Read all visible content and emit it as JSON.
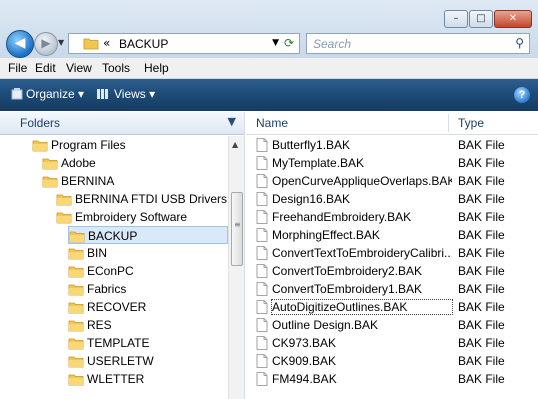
{
  "window": {
    "controls": {
      "minimize": "–",
      "maximize": "□",
      "close": "✕"
    }
  },
  "nav": {
    "back_glyph": "◀",
    "forward_glyph": "▶",
    "address_chevron": "«",
    "address_path": "BACKUP",
    "refresh_glyph": "⟳",
    "search_placeholder": "Search",
    "search_glyph": "⚲"
  },
  "menubar": {
    "items": [
      "File",
      "Edit",
      "View",
      "Tools",
      "Help"
    ]
  },
  "toolbar": {
    "organize": "Organize",
    "views": "Views",
    "help_glyph": "?"
  },
  "folders_pane": {
    "header": "Folders",
    "items": [
      {
        "label": "Program Files",
        "level": 0,
        "selected": false
      },
      {
        "label": "Adobe",
        "level": 1,
        "selected": false
      },
      {
        "label": "BERNINA",
        "level": 1,
        "selected": false
      },
      {
        "label": "BERNINA FTDI USB Drivers Disl",
        "level": 2,
        "selected": false
      },
      {
        "label": "Embroidery Software",
        "level": 2,
        "selected": false
      },
      {
        "label": "BACKUP",
        "level": 3,
        "selected": true
      },
      {
        "label": "BIN",
        "level": 3,
        "selected": false
      },
      {
        "label": "EConPC",
        "level": 3,
        "selected": false
      },
      {
        "label": "Fabrics",
        "level": 3,
        "selected": false
      },
      {
        "label": "RECOVER",
        "level": 3,
        "selected": false
      },
      {
        "label": "RES",
        "level": 3,
        "selected": false
      },
      {
        "label": "TEMPLATE",
        "level": 3,
        "selected": false
      },
      {
        "label": "USERLETW",
        "level": 3,
        "selected": false
      },
      {
        "label": "WLETTER",
        "level": 3,
        "selected": false
      }
    ]
  },
  "files_pane": {
    "columns": {
      "name": "Name",
      "type": "Type"
    },
    "rows": [
      {
        "name": "Butterfly1.BAK",
        "type": "BAK File"
      },
      {
        "name": "MyTemplate.BAK",
        "type": "BAK File"
      },
      {
        "name": "OpenCurveAppliqueOverlaps.BAK",
        "type": "BAK File"
      },
      {
        "name": "Design16.BAK",
        "type": "BAK File"
      },
      {
        "name": "FreehandEmbroidery.BAK",
        "type": "BAK File"
      },
      {
        "name": "MorphingEffect.BAK",
        "type": "BAK File"
      },
      {
        "name": "ConvertTextToEmbroideryCalibri...",
        "type": "BAK File"
      },
      {
        "name": "ConvertToEmbroidery2.BAK",
        "type": "BAK File"
      },
      {
        "name": "ConvertToEmbroidery1.BAK",
        "type": "BAK File"
      },
      {
        "name": "AutoDigitizeOutlines.BAK",
        "type": "BAK File",
        "focused": true
      },
      {
        "name": "Outline Design.BAK",
        "type": "BAK File"
      },
      {
        "name": "CK973.BAK",
        "type": "BAK File"
      },
      {
        "name": "CK909.BAK",
        "type": "BAK File"
      },
      {
        "name": "FM494.BAK",
        "type": "BAK File"
      }
    ]
  }
}
